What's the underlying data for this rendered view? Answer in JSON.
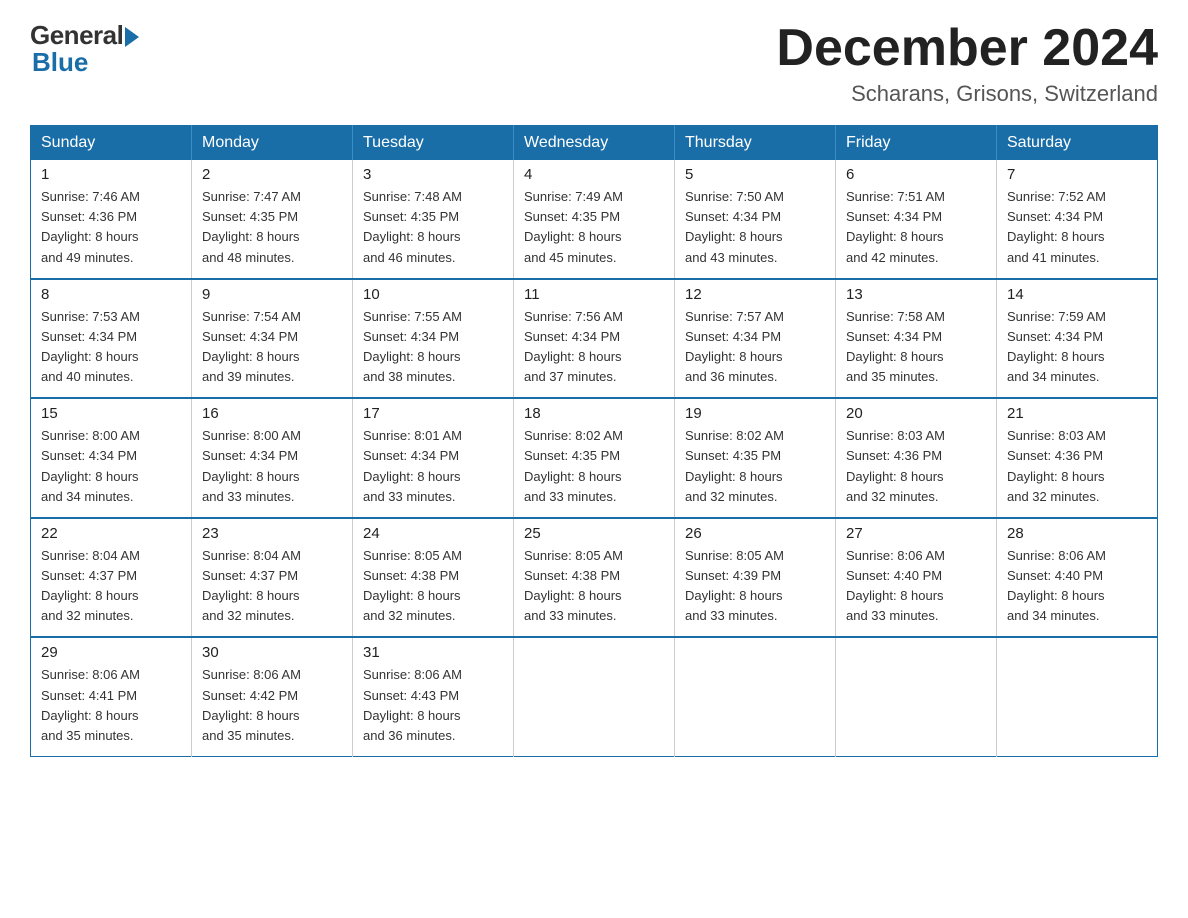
{
  "logo": {
    "general": "General",
    "blue": "Blue"
  },
  "title": "December 2024",
  "location": "Scharans, Grisons, Switzerland",
  "headers": [
    "Sunday",
    "Monday",
    "Tuesday",
    "Wednesday",
    "Thursday",
    "Friday",
    "Saturday"
  ],
  "weeks": [
    [
      {
        "day": "1",
        "info": "Sunrise: 7:46 AM\nSunset: 4:36 PM\nDaylight: 8 hours\nand 49 minutes."
      },
      {
        "day": "2",
        "info": "Sunrise: 7:47 AM\nSunset: 4:35 PM\nDaylight: 8 hours\nand 48 minutes."
      },
      {
        "day": "3",
        "info": "Sunrise: 7:48 AM\nSunset: 4:35 PM\nDaylight: 8 hours\nand 46 minutes."
      },
      {
        "day": "4",
        "info": "Sunrise: 7:49 AM\nSunset: 4:35 PM\nDaylight: 8 hours\nand 45 minutes."
      },
      {
        "day": "5",
        "info": "Sunrise: 7:50 AM\nSunset: 4:34 PM\nDaylight: 8 hours\nand 43 minutes."
      },
      {
        "day": "6",
        "info": "Sunrise: 7:51 AM\nSunset: 4:34 PM\nDaylight: 8 hours\nand 42 minutes."
      },
      {
        "day": "7",
        "info": "Sunrise: 7:52 AM\nSunset: 4:34 PM\nDaylight: 8 hours\nand 41 minutes."
      }
    ],
    [
      {
        "day": "8",
        "info": "Sunrise: 7:53 AM\nSunset: 4:34 PM\nDaylight: 8 hours\nand 40 minutes."
      },
      {
        "day": "9",
        "info": "Sunrise: 7:54 AM\nSunset: 4:34 PM\nDaylight: 8 hours\nand 39 minutes."
      },
      {
        "day": "10",
        "info": "Sunrise: 7:55 AM\nSunset: 4:34 PM\nDaylight: 8 hours\nand 38 minutes."
      },
      {
        "day": "11",
        "info": "Sunrise: 7:56 AM\nSunset: 4:34 PM\nDaylight: 8 hours\nand 37 minutes."
      },
      {
        "day": "12",
        "info": "Sunrise: 7:57 AM\nSunset: 4:34 PM\nDaylight: 8 hours\nand 36 minutes."
      },
      {
        "day": "13",
        "info": "Sunrise: 7:58 AM\nSunset: 4:34 PM\nDaylight: 8 hours\nand 35 minutes."
      },
      {
        "day": "14",
        "info": "Sunrise: 7:59 AM\nSunset: 4:34 PM\nDaylight: 8 hours\nand 34 minutes."
      }
    ],
    [
      {
        "day": "15",
        "info": "Sunrise: 8:00 AM\nSunset: 4:34 PM\nDaylight: 8 hours\nand 34 minutes."
      },
      {
        "day": "16",
        "info": "Sunrise: 8:00 AM\nSunset: 4:34 PM\nDaylight: 8 hours\nand 33 minutes."
      },
      {
        "day": "17",
        "info": "Sunrise: 8:01 AM\nSunset: 4:34 PM\nDaylight: 8 hours\nand 33 minutes."
      },
      {
        "day": "18",
        "info": "Sunrise: 8:02 AM\nSunset: 4:35 PM\nDaylight: 8 hours\nand 33 minutes."
      },
      {
        "day": "19",
        "info": "Sunrise: 8:02 AM\nSunset: 4:35 PM\nDaylight: 8 hours\nand 32 minutes."
      },
      {
        "day": "20",
        "info": "Sunrise: 8:03 AM\nSunset: 4:36 PM\nDaylight: 8 hours\nand 32 minutes."
      },
      {
        "day": "21",
        "info": "Sunrise: 8:03 AM\nSunset: 4:36 PM\nDaylight: 8 hours\nand 32 minutes."
      }
    ],
    [
      {
        "day": "22",
        "info": "Sunrise: 8:04 AM\nSunset: 4:37 PM\nDaylight: 8 hours\nand 32 minutes."
      },
      {
        "day": "23",
        "info": "Sunrise: 8:04 AM\nSunset: 4:37 PM\nDaylight: 8 hours\nand 32 minutes."
      },
      {
        "day": "24",
        "info": "Sunrise: 8:05 AM\nSunset: 4:38 PM\nDaylight: 8 hours\nand 32 minutes."
      },
      {
        "day": "25",
        "info": "Sunrise: 8:05 AM\nSunset: 4:38 PM\nDaylight: 8 hours\nand 33 minutes."
      },
      {
        "day": "26",
        "info": "Sunrise: 8:05 AM\nSunset: 4:39 PM\nDaylight: 8 hours\nand 33 minutes."
      },
      {
        "day": "27",
        "info": "Sunrise: 8:06 AM\nSunset: 4:40 PM\nDaylight: 8 hours\nand 33 minutes."
      },
      {
        "day": "28",
        "info": "Sunrise: 8:06 AM\nSunset: 4:40 PM\nDaylight: 8 hours\nand 34 minutes."
      }
    ],
    [
      {
        "day": "29",
        "info": "Sunrise: 8:06 AM\nSunset: 4:41 PM\nDaylight: 8 hours\nand 35 minutes."
      },
      {
        "day": "30",
        "info": "Sunrise: 8:06 AM\nSunset: 4:42 PM\nDaylight: 8 hours\nand 35 minutes."
      },
      {
        "day": "31",
        "info": "Sunrise: 8:06 AM\nSunset: 4:43 PM\nDaylight: 8 hours\nand 36 minutes."
      },
      {
        "day": "",
        "info": ""
      },
      {
        "day": "",
        "info": ""
      },
      {
        "day": "",
        "info": ""
      },
      {
        "day": "",
        "info": ""
      }
    ]
  ]
}
